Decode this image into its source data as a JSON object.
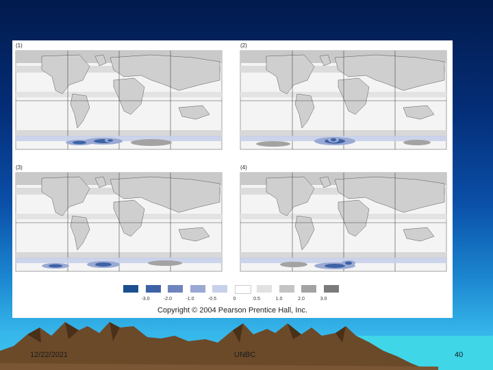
{
  "slide": {
    "footer": {
      "date": "12/22/2021",
      "center": "UNBC",
      "page": "40"
    }
  },
  "figure": {
    "panels": [
      {
        "label": "(1)"
      },
      {
        "label": "(2)"
      },
      {
        "label": "(3)"
      },
      {
        "label": "(4)"
      }
    ],
    "legend": {
      "ticks": [
        "-3.0",
        "-2.0",
        "-1.0",
        "-0.5",
        "0",
        "0.5",
        "1.0",
        "2.0",
        "3.0"
      ],
      "colors": [
        "#1b4f8f",
        "#3d62a5",
        "#6f84bd",
        "#9aa9d3",
        "#c8d0ea",
        "#ffffff",
        "#e1e1e1",
        "#c4c4c4",
        "#a3a3a3",
        "#7b7b7b"
      ]
    },
    "copyright": "Copyright © 2004 Pearson Prentice Hall, Inc."
  }
}
